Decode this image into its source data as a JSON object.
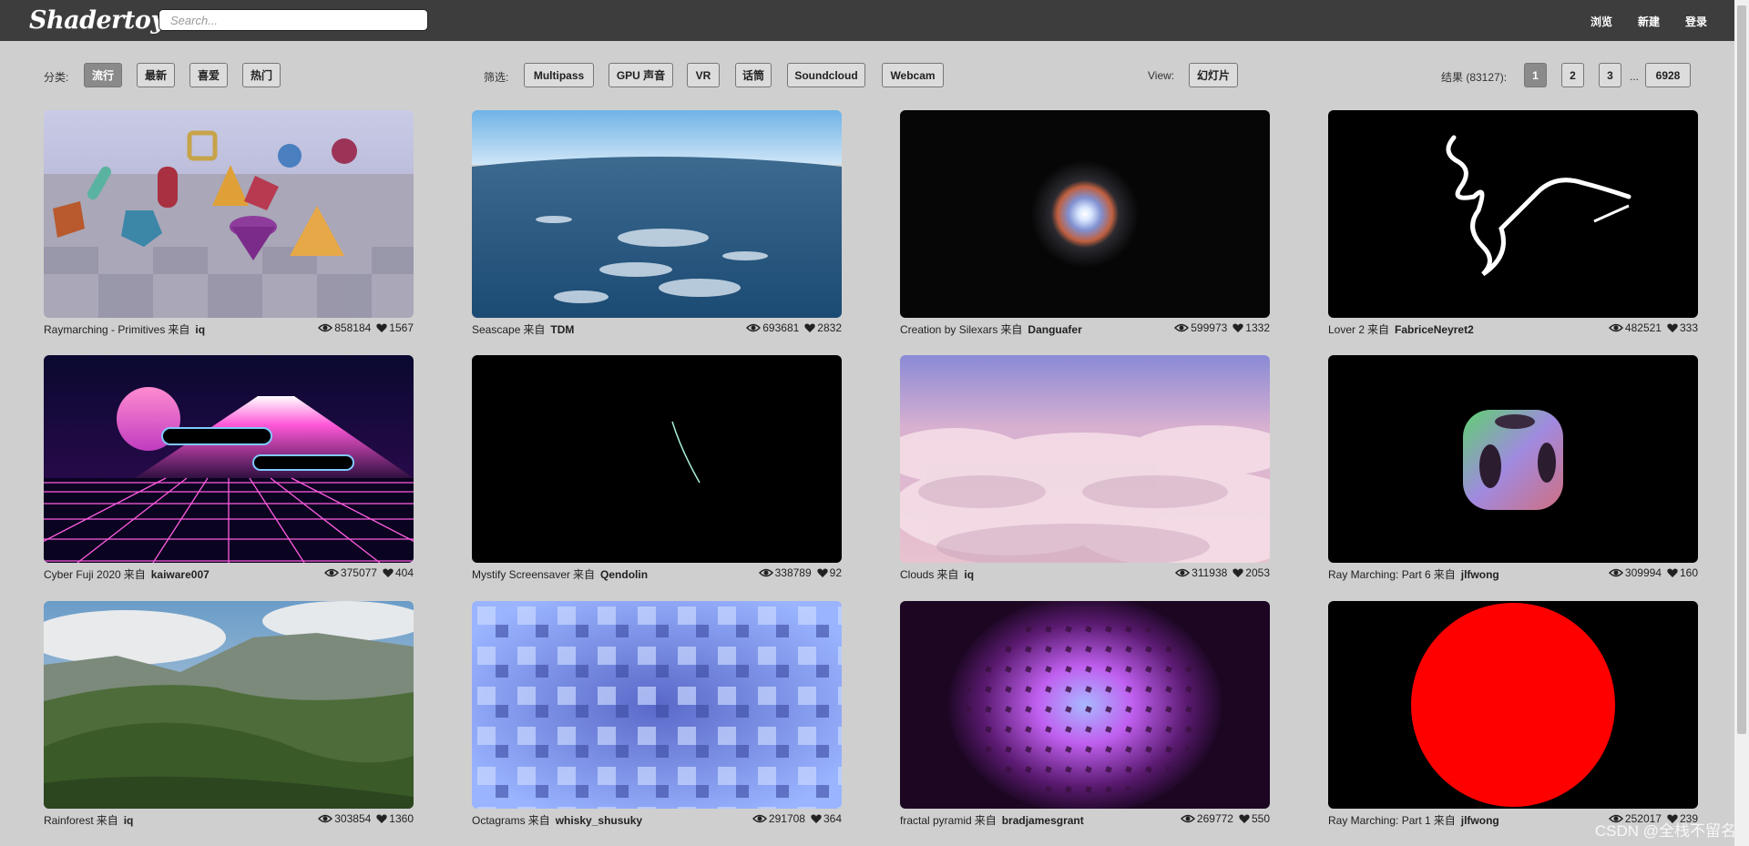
{
  "header": {
    "logo": "Shadertoy",
    "search_placeholder": "Search...",
    "nav": [
      "浏览",
      "新建",
      "登录"
    ]
  },
  "filters": {
    "category_label": "分类:",
    "categories": [
      "流行",
      "最新",
      "喜爱",
      "热门"
    ],
    "filter_label": "筛选:",
    "filter_options": [
      "Multipass",
      "GPU 声音",
      "VR",
      "话筒",
      "Soundcloud",
      "Webcam"
    ],
    "view_label": "View:",
    "view_option": "幻灯片",
    "results_label": "结果 (83127):",
    "pages": [
      "1",
      "2",
      "3",
      "6928"
    ],
    "ellipsis": "..."
  },
  "from_label": "来自",
  "shaders": [
    {
      "title": "Raymarching - Primitives",
      "author": "iq",
      "views": "858184",
      "likes": "1567",
      "thumb": "primitives"
    },
    {
      "title": "Seascape",
      "author": "TDM",
      "views": "693681",
      "likes": "2832",
      "thumb": "seascape"
    },
    {
      "title": "Creation by Silexars",
      "author": "Danguafer",
      "views": "599973",
      "likes": "1332",
      "thumb": "creation"
    },
    {
      "title": "Lover 2",
      "author": "FabriceNeyret2",
      "views": "482521",
      "likes": "333",
      "thumb": "lover"
    },
    {
      "title": "Cyber Fuji 2020",
      "author": "kaiware007",
      "views": "375077",
      "likes": "404",
      "thumb": "fuji"
    },
    {
      "title": "Mystify Screensaver",
      "author": "Qendolin",
      "views": "338789",
      "likes": "92",
      "thumb": "mystify"
    },
    {
      "title": "Clouds",
      "author": "iq",
      "views": "311938",
      "likes": "2053",
      "thumb": "clouds"
    },
    {
      "title": "Ray Marching: Part 6",
      "author": "jlfwong",
      "views": "309994",
      "likes": "160",
      "thumb": "cube"
    },
    {
      "title": "Rainforest",
      "author": "iq",
      "views": "303854",
      "likes": "1360",
      "thumb": "rainforest"
    },
    {
      "title": "Octagrams",
      "author": "whisky_shusuky",
      "views": "291708",
      "likes": "364",
      "thumb": "octagrams"
    },
    {
      "title": "fractal pyramid",
      "author": "bradjamesgrant",
      "views": "269772",
      "likes": "550",
      "thumb": "fractal"
    },
    {
      "title": "Ray Marching: Part 1",
      "author": "jlfwong",
      "views": "252017",
      "likes": "239",
      "thumb": "redcircle"
    }
  ],
  "watermark": "CSDN @全栈不留名"
}
